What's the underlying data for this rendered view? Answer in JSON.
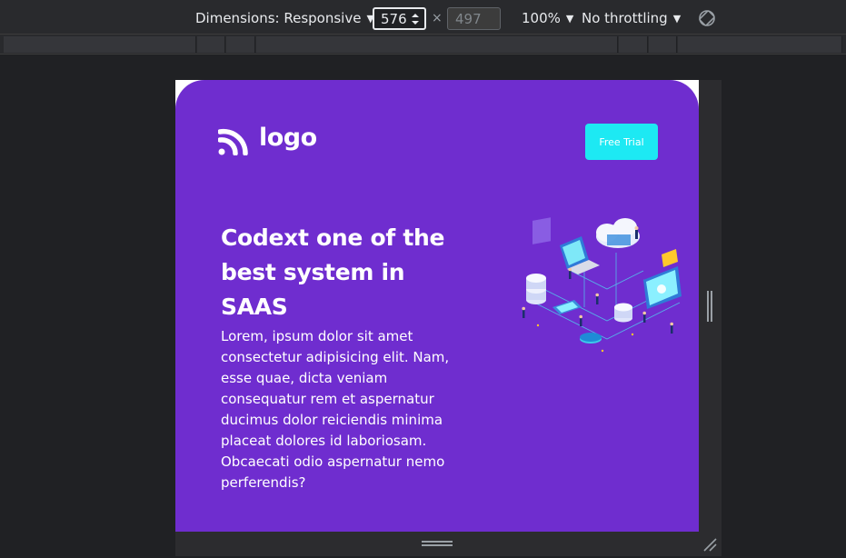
{
  "devtools": {
    "dimensions_label": "Dimensions: Responsive",
    "width_value": "576",
    "times_symbol": "×",
    "height_placeholder": "497",
    "zoom_label": "100%",
    "throttling_label": "No throttling",
    "caret": "▼",
    "icons": {
      "rotate": "rotate-icon",
      "spinner": "spinner-icon",
      "resize_vertical": "resize-handle-icon",
      "resize_horizontal": "resize-handle-icon",
      "corner": "corner-resize-icon"
    }
  },
  "page": {
    "logo_text": "logo",
    "cta_label": "Free Trial",
    "headline": "Codext one of the best system in SAAS",
    "body": "Lorem, ipsum dolor sit amet consectetur adipisicing elit. Nam, esse quae, dicta veniam consequatur rem et aspernatur ducimus dolor reiciendis minima placeat dolores id laboriosam. Obcaecati odio aspernatur nemo perferendis?",
    "colors": {
      "hero_bg": "#6f2dcf",
      "cta_bg": "#1de9f3",
      "text": "#ffffff"
    },
    "illustration": "cloud-network-illustration"
  }
}
